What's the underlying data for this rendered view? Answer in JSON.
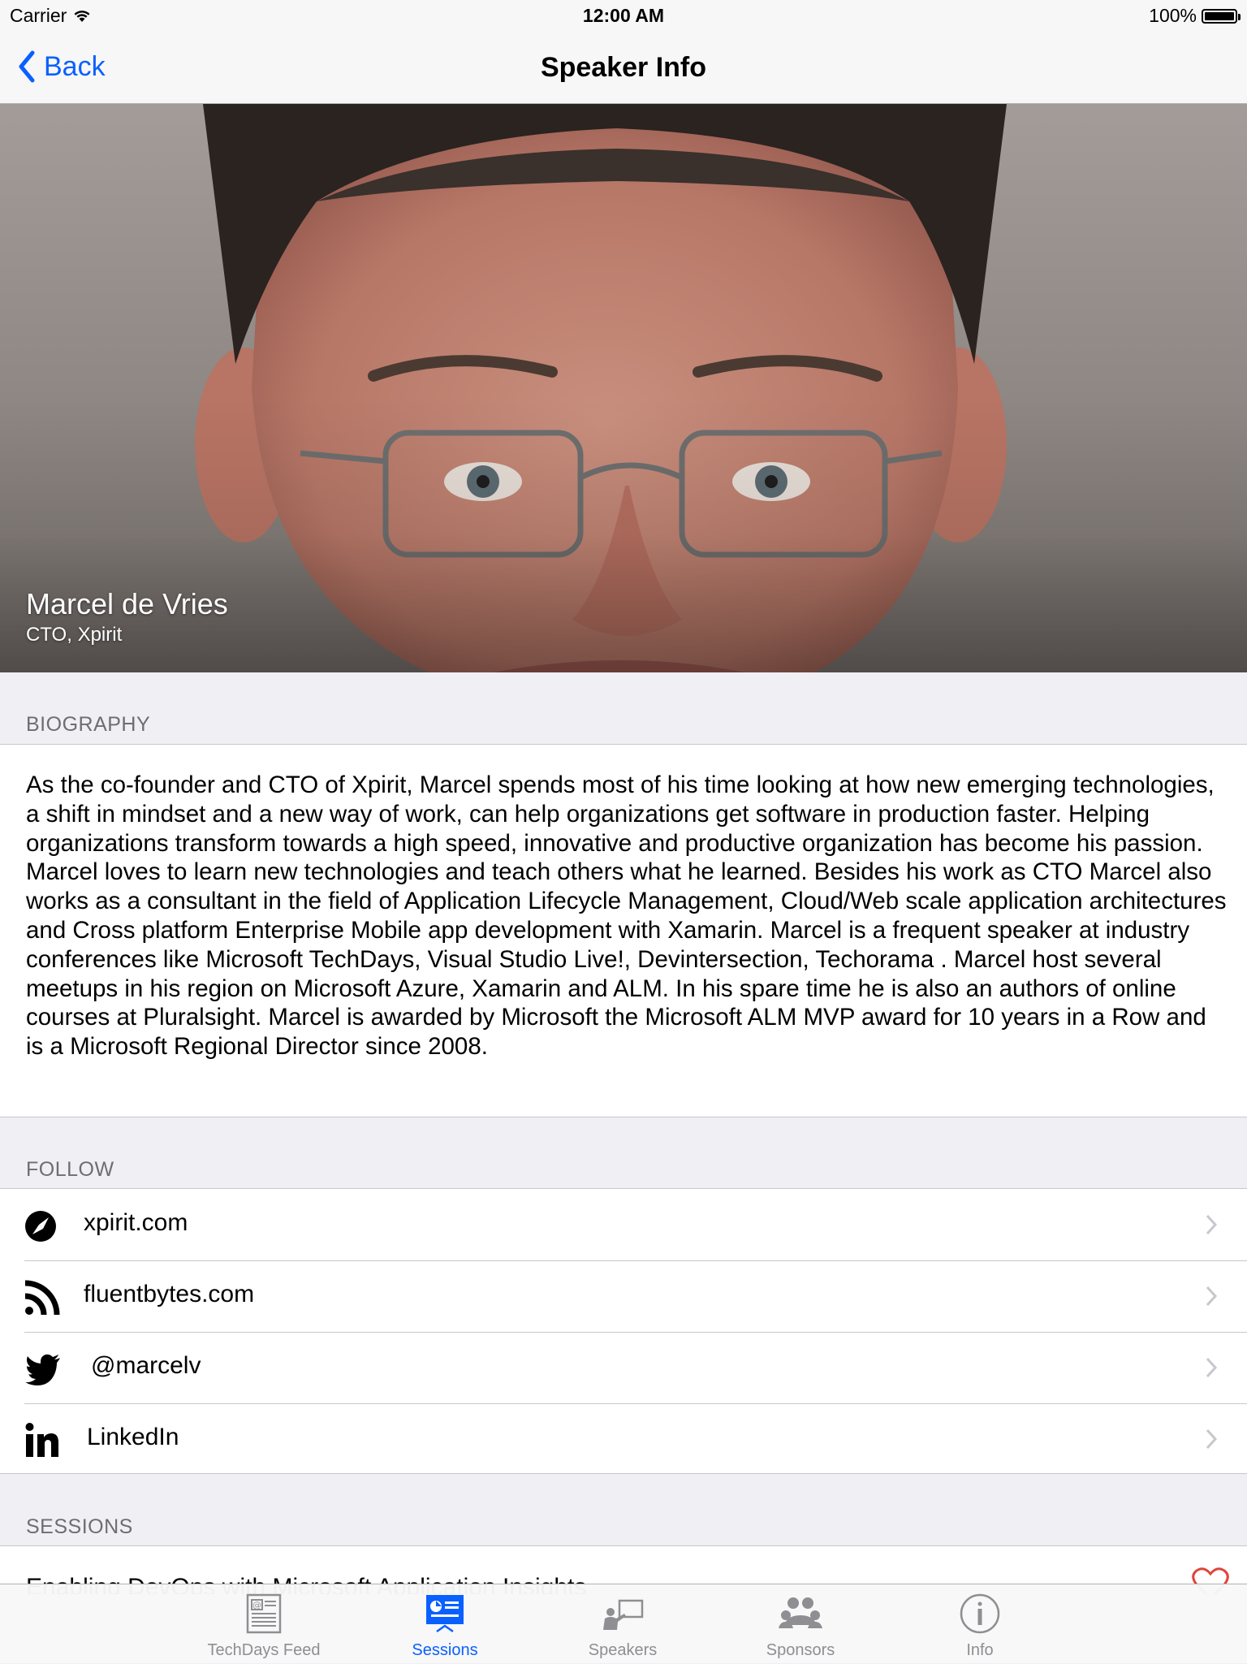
{
  "status_bar": {
    "carrier": "Carrier",
    "time": "12:00 AM",
    "battery": "100%"
  },
  "nav": {
    "back_label": "Back",
    "title": "Speaker Info"
  },
  "speaker": {
    "name": "Marcel de Vries",
    "title": "CTO, Xpirit"
  },
  "biography": {
    "header": "BIOGRAPHY",
    "text": "As the co-founder and CTO of Xpirit, Marcel spends most of his time looking at how new emerging technologies, a shift in mindset and a new way of work, can help organizations get software in production faster. Helping organizations transform towards a high speed, innovative and productive organization has become his passion. Marcel loves to learn new technologies and teach others what he learned. Besides his work as CTO Marcel also works as a consultant in the field of Application Lifecycle Management, Cloud/Web scale application architectures and Cross platform Enterprise Mobile app development with Xamarin. Marcel is a frequent speaker at industry conferences like Microsoft TechDays, Visual Studio Live!, Devintersection, Techorama . Marcel host several meetups in his region on Microsoft Azure, Xamarin and ALM. In his spare time he is also an authors of online courses at Pluralsight. Marcel is awarded by Microsoft the Microsoft ALM MVP award for 10 years in a Row and is a Microsoft Regional Director since 2008."
  },
  "follow": {
    "header": "FOLLOW",
    "items": [
      {
        "label": "xpirit.com",
        "icon": "compass-icon"
      },
      {
        "label": "fluentbytes.com",
        "icon": "rss-icon"
      },
      {
        "label": "@marcelv",
        "icon": "twitter-icon"
      },
      {
        "label": "LinkedIn",
        "icon": "linkedin-icon"
      }
    ]
  },
  "sessions": {
    "header": "SESSIONS",
    "items": [
      {
        "title": "Enabling DevOps with Microsoft Application Insights",
        "favorite_icon": "heart-icon"
      }
    ]
  },
  "tabs": [
    {
      "label": "TechDays Feed",
      "icon": "feed-icon",
      "active": false
    },
    {
      "label": "Sessions",
      "icon": "sessions-icon",
      "active": true
    },
    {
      "label": "Speakers",
      "icon": "speakers-icon",
      "active": false
    },
    {
      "label": "Sponsors",
      "icon": "sponsors-icon",
      "active": false
    },
    {
      "label": "Info",
      "icon": "info-icon",
      "active": false
    }
  ],
  "colors": {
    "accent": "#0a60ff",
    "tab_inactive": "#8e8e93",
    "background": "#efeff4",
    "heart": "#e0443a"
  }
}
